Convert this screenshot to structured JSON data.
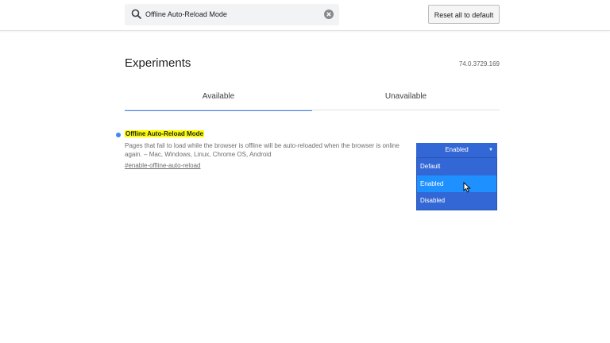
{
  "search": {
    "value": "Offline Auto-Reload Mode"
  },
  "header": {
    "reset_label": "Reset all to default"
  },
  "page": {
    "title": "Experiments",
    "version": "74.0.3729.169"
  },
  "tabs": [
    {
      "label": "Available"
    },
    {
      "label": "Unavailable"
    }
  ],
  "experiment": {
    "name": "Offline Auto-Reload Mode",
    "description": "Pages that fail to load while the browser is offline will be auto-reloaded when the browser is online again. – Mac, Windows, Linux, Chrome OS, Android",
    "link": "#enable-offline-auto-reload",
    "selected": "Enabled",
    "options": [
      "Default",
      "Enabled",
      "Disabled"
    ],
    "highlighted_option": "Enabled"
  },
  "colors": {
    "accent": "#4285f4",
    "select_bg": "#3367d6",
    "highlight": "#1e90ff",
    "match": "#ffff00"
  },
  "icons": [
    "search-icon",
    "clear-icon",
    "chevron-down-icon",
    "mouse-cursor-icon"
  ]
}
